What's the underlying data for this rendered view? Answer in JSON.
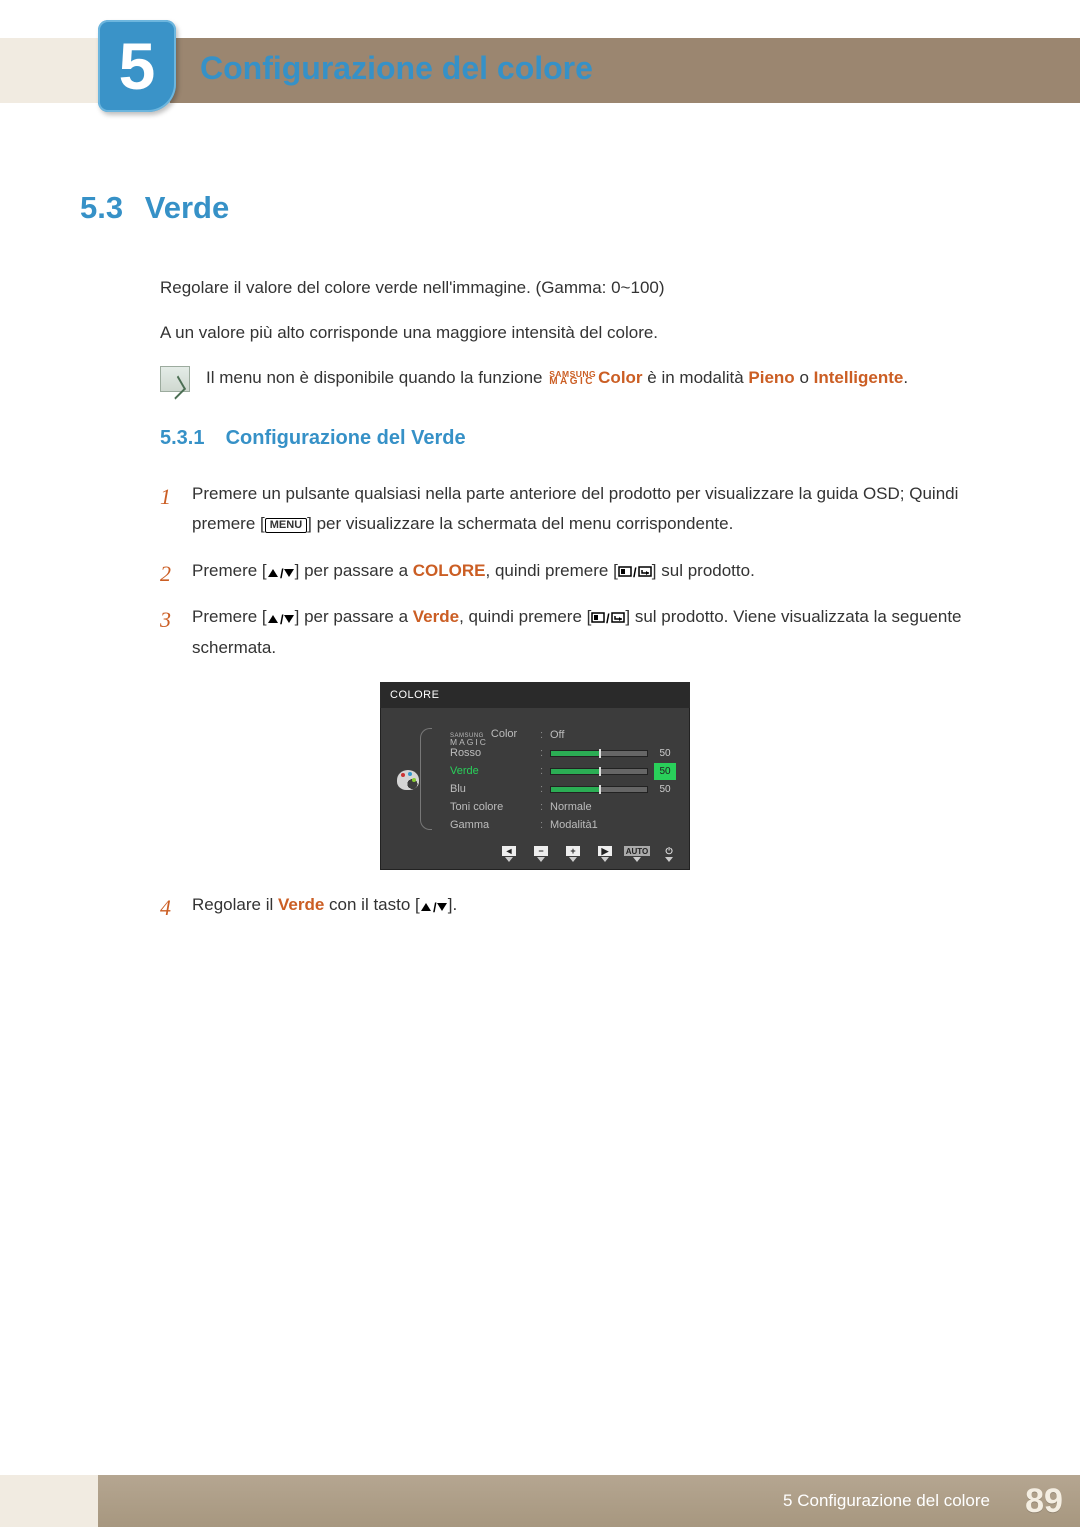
{
  "chapter": {
    "number": "5",
    "title": "Configurazione del colore"
  },
  "section": {
    "number": "5.3",
    "title": "Verde",
    "p1": "Regolare il valore del colore verde nell'immagine. (Gamma: 0~100)",
    "p2": "A un valore più alto corrisponde una maggiore intensità del colore."
  },
  "note": {
    "pre": "Il menu non è disponibile quando la funzione ",
    "brand_top": "SAMSUNG",
    "brand_bot": "MAGIC",
    "brand_word": "Color",
    "mid": " è in modalità ",
    "m1": "Pieno",
    "or": " o ",
    "m2": "Intelligente",
    "end": "."
  },
  "subsection": {
    "number": "5.3.1",
    "title": "Configurazione del Verde"
  },
  "steps": {
    "s1a": "Premere un pulsante qualsiasi nella parte anteriore del prodotto per visualizzare la guida OSD; Quindi premere [",
    "s1_btn": "MENU",
    "s1b": "] per visualizzare la schermata del menu corrispondente.",
    "s2a": "Premere [",
    "s2b": "] per passare a ",
    "s2_target": "COLORE",
    "s2c": ", quindi premere [",
    "s2d": "] sul prodotto.",
    "s3a": "Premere [",
    "s3b": "] per passare a ",
    "s3_target": "Verde",
    "s3c": ", quindi premere [",
    "s3d": "] sul prodotto. Viene visualizzata la seguente schermata.",
    "s4a": "Regolare il ",
    "s4_target": "Verde",
    "s4b": " con il tasto [",
    "s4c": "]."
  },
  "osd": {
    "title": "COLORE",
    "rows": [
      {
        "label_brand": true,
        "label_suffix": " Color",
        "value_text": "Off"
      },
      {
        "label": "Rosso",
        "slider": 50,
        "num": "50"
      },
      {
        "label": "Verde",
        "slider": 50,
        "num": "50",
        "selected": true
      },
      {
        "label": "Blu",
        "slider": 50,
        "num": "50"
      },
      {
        "label": "Toni colore",
        "value_text": "Normale"
      },
      {
        "label": "Gamma",
        "value_text": "Modalità1"
      }
    ],
    "nav": {
      "auto": "AUTO"
    }
  },
  "footer": {
    "text": "5 Configurazione del colore",
    "page": "89"
  },
  "chart_data": {
    "type": "bar",
    "title": "COLORE OSD sliders",
    "categories": [
      "Rosso",
      "Verde",
      "Blu"
    ],
    "values": [
      50,
      50,
      50
    ],
    "ylim": [
      0,
      100
    ],
    "xlabel": "",
    "ylabel": ""
  }
}
